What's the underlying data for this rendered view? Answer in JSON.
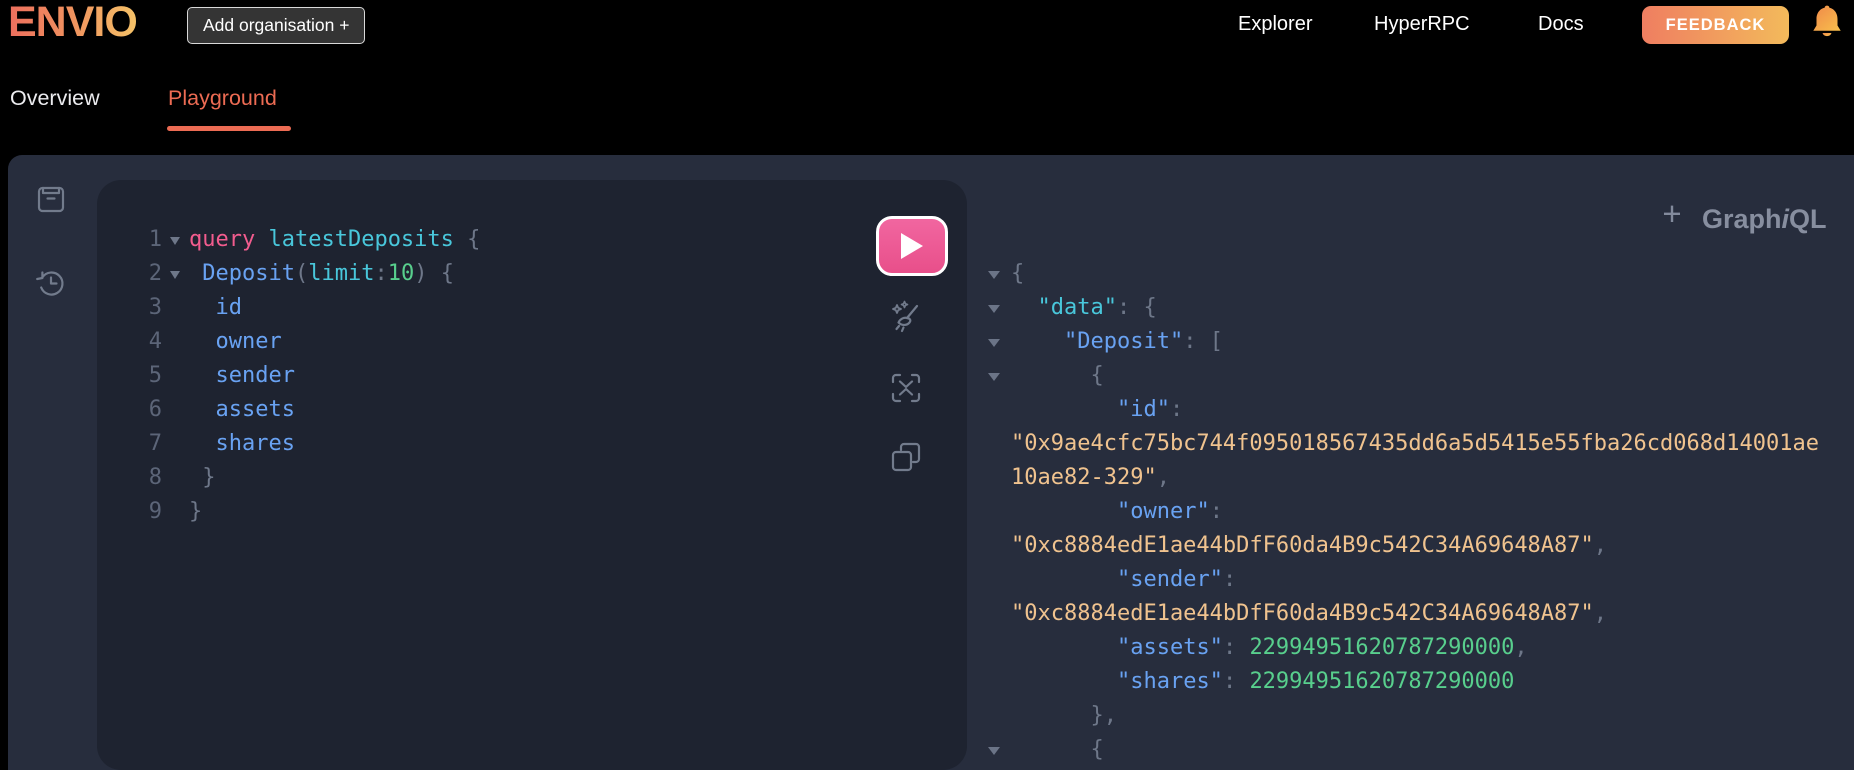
{
  "header": {
    "logo_text": "ENVIO",
    "add_org_button": "Add organisation +",
    "nav": [
      "Explorer",
      "HyperRPC",
      "Docs"
    ],
    "feedback_button": "FEEDBACK"
  },
  "tabs": {
    "overview": "Overview",
    "playground": "Playground",
    "active": "Playground"
  },
  "graphiql": {
    "brand": {
      "plus": "+",
      "part1": "Graph",
      "part2": "i",
      "part3": "QL"
    },
    "editor": {
      "lines": [
        {
          "n": "1",
          "fold": true,
          "segs": [
            [
              "query",
              "kw"
            ],
            [
              " ",
              "pl"
            ],
            [
              "latestDeposits",
              "def"
            ],
            [
              " {",
              "pun"
            ]
          ]
        },
        {
          "n": "2",
          "fold": true,
          "segs": [
            [
              " ",
              "pl"
            ],
            [
              "Deposit",
              "prop"
            ],
            [
              "(",
              "pun"
            ],
            [
              "limit",
              "def"
            ],
            [
              ":",
              "pun"
            ],
            [
              "10",
              "num"
            ],
            [
              ") {",
              "pun"
            ]
          ]
        },
        {
          "n": "3",
          "fold": false,
          "segs": [
            [
              "  ",
              "pl"
            ],
            [
              "id",
              "prop"
            ]
          ]
        },
        {
          "n": "4",
          "fold": false,
          "segs": [
            [
              "  ",
              "pl"
            ],
            [
              "owner",
              "prop"
            ]
          ]
        },
        {
          "n": "5",
          "fold": false,
          "segs": [
            [
              "  ",
              "pl"
            ],
            [
              "sender",
              "prop"
            ]
          ]
        },
        {
          "n": "6",
          "fold": false,
          "segs": [
            [
              "  ",
              "pl"
            ],
            [
              "assets",
              "prop"
            ]
          ]
        },
        {
          "n": "7",
          "fold": false,
          "segs": [
            [
              "  ",
              "pl"
            ],
            [
              "shares",
              "prop"
            ]
          ]
        },
        {
          "n": "8",
          "fold": false,
          "segs": [
            [
              " }",
              "pun"
            ]
          ]
        },
        {
          "n": "9",
          "fold": false,
          "segs": [
            [
              "}",
              "pun"
            ]
          ]
        }
      ]
    },
    "response": {
      "lines": [
        {
          "fold": true,
          "segs": [
            [
              "{",
              "pun"
            ]
          ]
        },
        {
          "fold": true,
          "segs": [
            [
              "  ",
              "pl"
            ],
            [
              "\"data\"",
              "def"
            ],
            [
              ": {",
              "pun"
            ]
          ]
        },
        {
          "fold": true,
          "segs": [
            [
              "    ",
              "pl"
            ],
            [
              "\"Deposit\"",
              "prop"
            ],
            [
              ": [",
              "pun"
            ]
          ]
        },
        {
          "fold": true,
          "segs": [
            [
              "      {",
              "pun"
            ]
          ]
        },
        {
          "fold": false,
          "segs": [
            [
              "        ",
              "pl"
            ],
            [
              "\"id\"",
              "prop"
            ],
            [
              ":",
              "pun"
            ]
          ]
        },
        {
          "fold": false,
          "segs": [
            [
              "\"0x9ae4cfc75bc744f095018567435dd6a5d5415e55fba26cd068d14001ae",
              "str"
            ]
          ]
        },
        {
          "fold": false,
          "segs": [
            [
              "10ae82-329\"",
              "str"
            ],
            [
              ",",
              "pun"
            ]
          ]
        },
        {
          "fold": false,
          "segs": [
            [
              "        ",
              "pl"
            ],
            [
              "\"owner\"",
              "prop"
            ],
            [
              ":",
              "pun"
            ]
          ]
        },
        {
          "fold": false,
          "segs": [
            [
              "\"0xc8884edE1ae44bDfF60da4B9c542C34A69648A87\"",
              "str"
            ],
            [
              ",",
              "pun"
            ]
          ]
        },
        {
          "fold": false,
          "segs": [
            [
              "        ",
              "pl"
            ],
            [
              "\"sender\"",
              "prop"
            ],
            [
              ":",
              "pun"
            ]
          ]
        },
        {
          "fold": false,
          "segs": [
            [
              "\"0xc8884edE1ae44bDfF60da4B9c542C34A69648A87\"",
              "str"
            ],
            [
              ",",
              "pun"
            ]
          ]
        },
        {
          "fold": false,
          "segs": [
            [
              "        ",
              "pl"
            ],
            [
              "\"assets\"",
              "prop"
            ],
            [
              ": ",
              "pun"
            ],
            [
              "22994951620787290000",
              "num"
            ],
            [
              ",",
              "pun"
            ]
          ]
        },
        {
          "fold": false,
          "segs": [
            [
              "        ",
              "pl"
            ],
            [
              "\"shares\"",
              "prop"
            ],
            [
              ": ",
              "pun"
            ],
            [
              "22994951620787290000",
              "num"
            ]
          ]
        },
        {
          "fold": false,
          "segs": [
            [
              "      },",
              "pun"
            ]
          ]
        },
        {
          "fold": true,
          "segs": [
            [
              "      {",
              "pun"
            ]
          ]
        }
      ]
    }
  },
  "icons": {
    "run": "play-triangle",
    "docs": "book-box",
    "history": "clock-restore-arrow",
    "prettify": "broom-sparkles",
    "merge": "collapse-brackets",
    "copy": "overlapping-squares",
    "bell": "notification-bell",
    "add_tab": "plus"
  },
  "colors": {
    "accent": "#EC6B53",
    "run_button_pink": "#EC5890",
    "logo_gradient": [
      "#ED6F5E",
      "#F5C268"
    ],
    "feedback_gradient": [
      "#EF7E61",
      "#F3BA5B"
    ],
    "panel_bg": "#272D3D",
    "editor_bg": "#1E2330",
    "code": {
      "keyword": "#F25C8E",
      "name": "#49C7DB",
      "field": "#69A2F2",
      "number": "#58CF8D",
      "string": "#F0C38F",
      "punctuation": "#6E7789"
    }
  }
}
